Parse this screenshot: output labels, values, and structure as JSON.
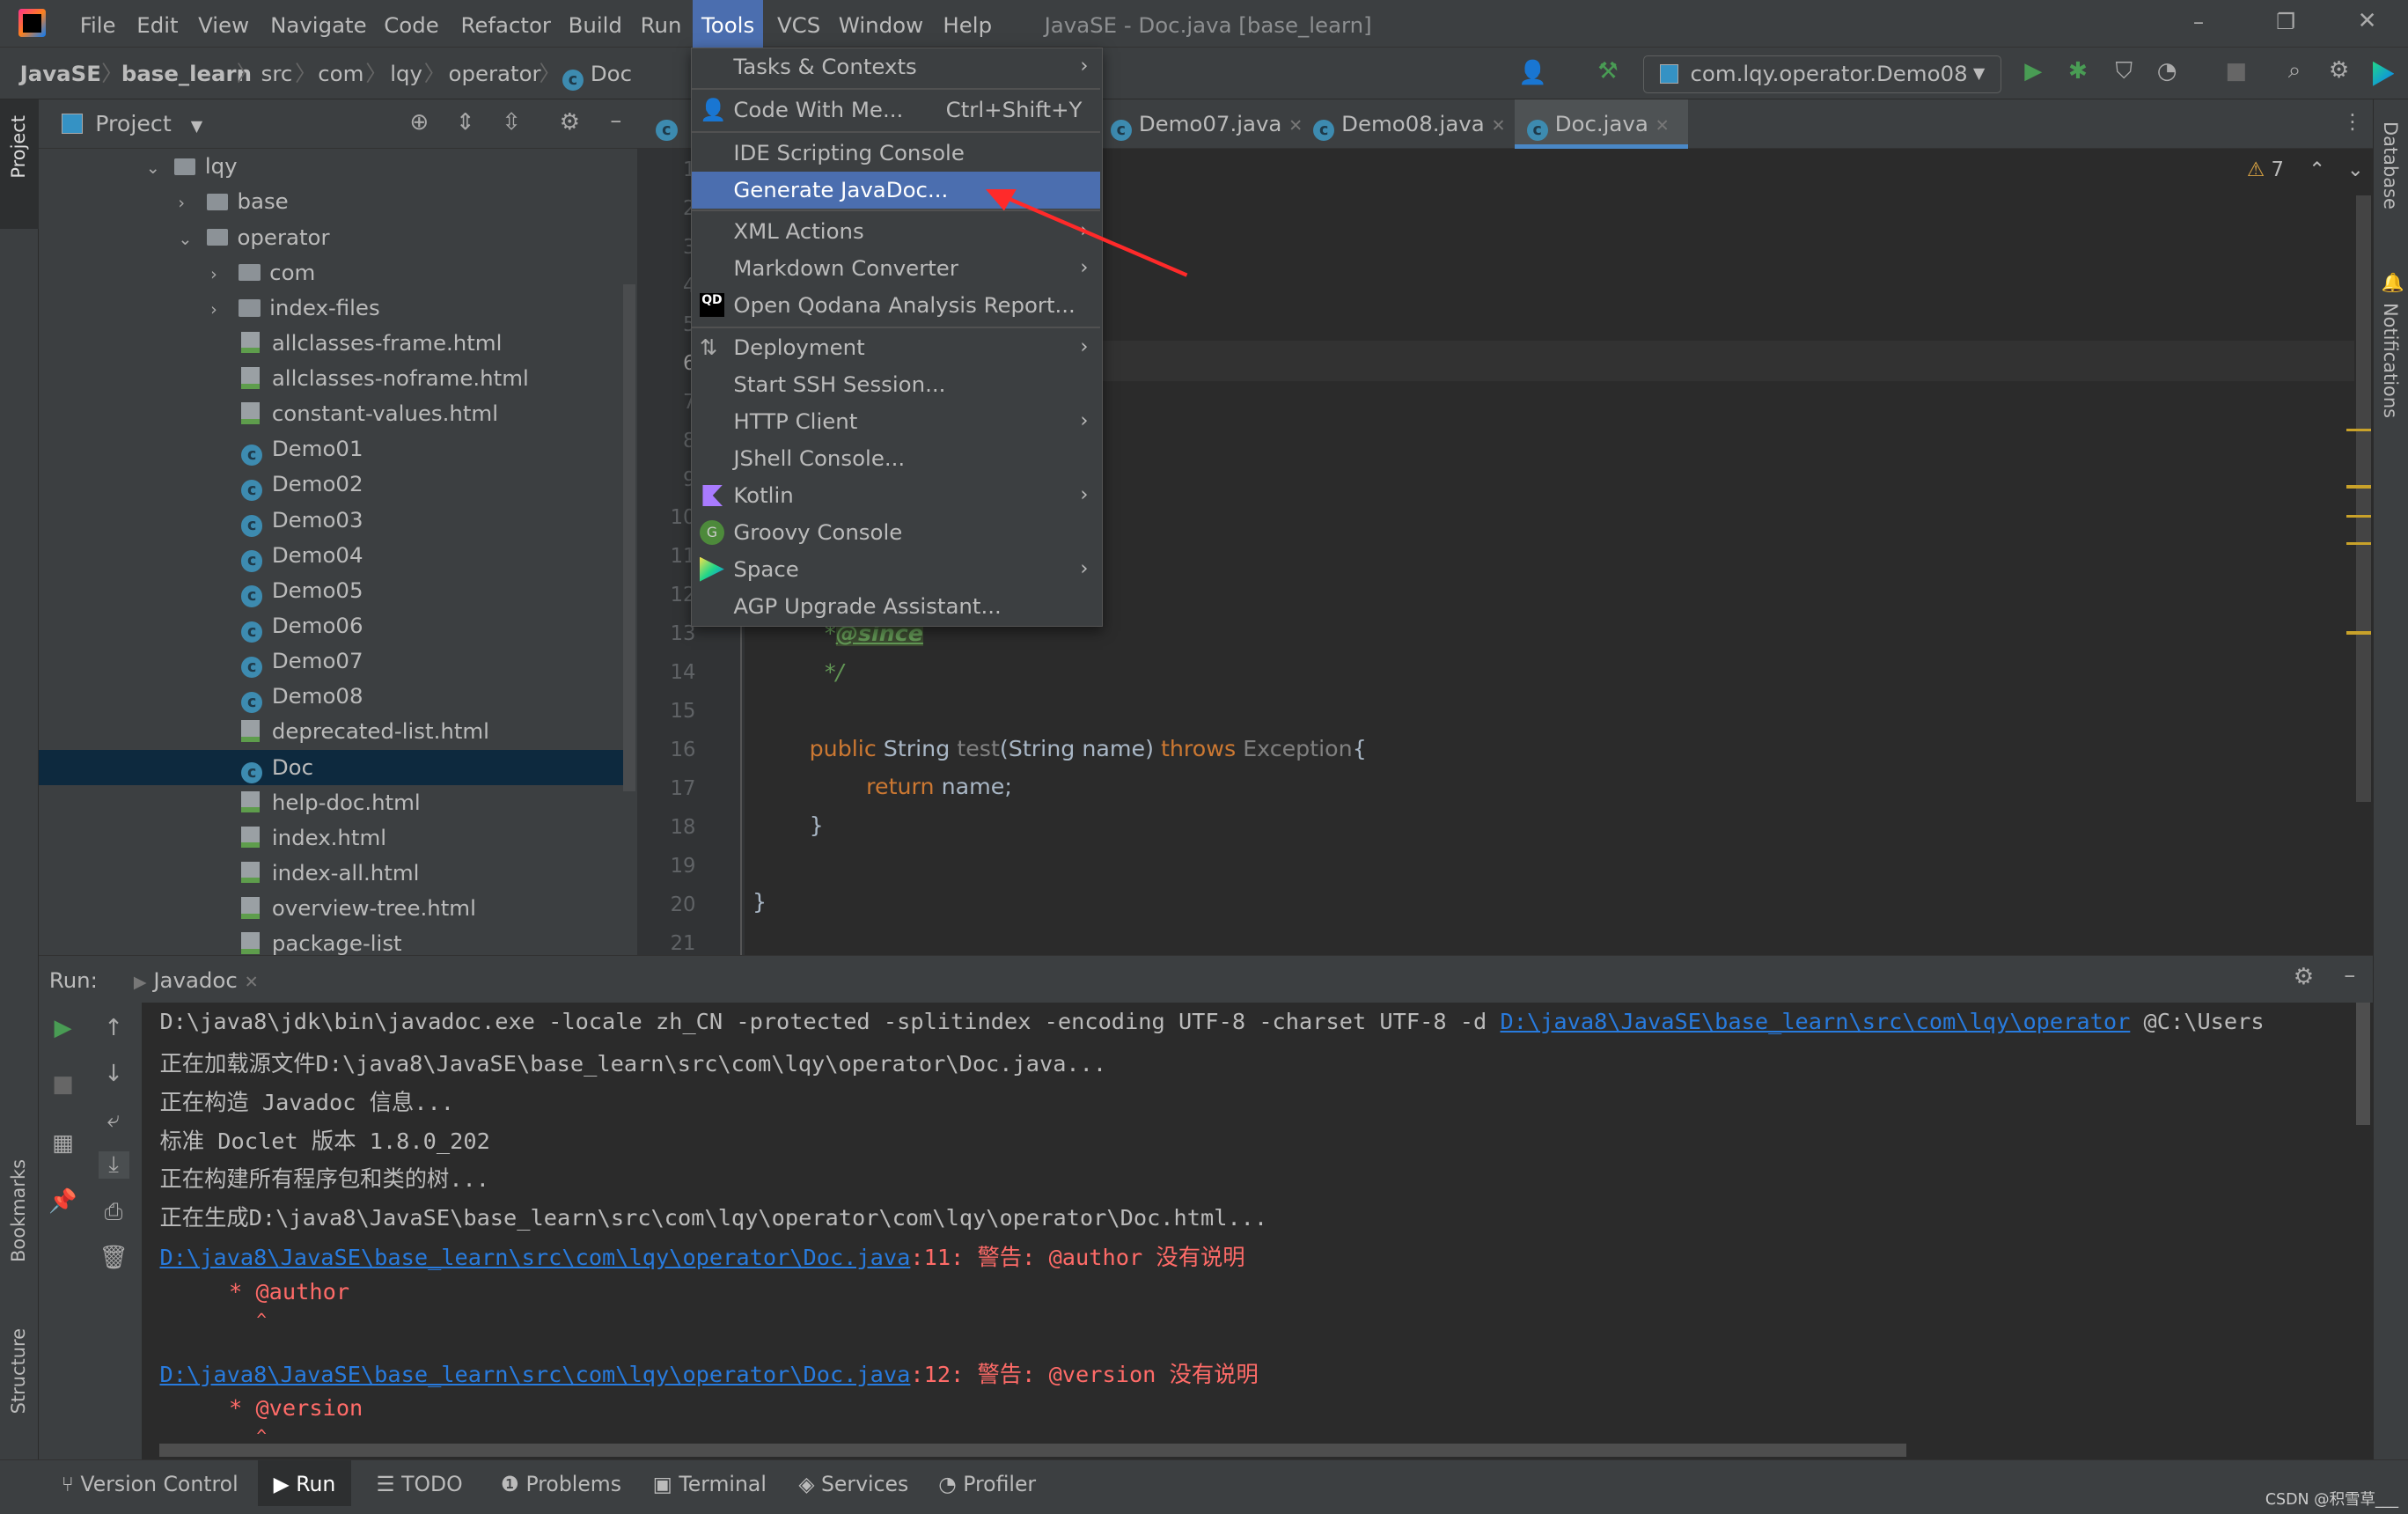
{
  "menubar": {
    "items": [
      "File",
      "Edit",
      "View",
      "Navigate",
      "Code",
      "Refactor",
      "Build",
      "Run",
      "Tools",
      "VCS",
      "Window",
      "Help"
    ],
    "active": "Tools",
    "window_title": "JavaSE - Doc.java [base_learn]"
  },
  "breadcrumb": [
    "JavaSE",
    "base_learn",
    "src",
    "com",
    "lqy",
    "operator",
    "Doc"
  ],
  "toolbar": {
    "run_config": "com.lqy.operator.Demo08"
  },
  "project": {
    "title": "Project",
    "tree": [
      {
        "label": "lqy",
        "type": "folder",
        "depth": 0,
        "expanded": true
      },
      {
        "label": "base",
        "type": "folder",
        "depth": 1,
        "expanded": false
      },
      {
        "label": "operator",
        "type": "folder",
        "depth": 1,
        "expanded": true
      },
      {
        "label": "com",
        "type": "folder",
        "depth": 2,
        "expanded": false
      },
      {
        "label": "index-files",
        "type": "folder",
        "depth": 2,
        "expanded": false
      },
      {
        "label": "allclasses-frame.html",
        "type": "html",
        "depth": 2
      },
      {
        "label": "allclasses-noframe.html",
        "type": "html",
        "depth": 2
      },
      {
        "label": "constant-values.html",
        "type": "html",
        "depth": 2
      },
      {
        "label": "Demo01",
        "type": "class",
        "depth": 2
      },
      {
        "label": "Demo02",
        "type": "class",
        "depth": 2
      },
      {
        "label": "Demo03",
        "type": "class",
        "depth": 2
      },
      {
        "label": "Demo04",
        "type": "class",
        "depth": 2
      },
      {
        "label": "Demo05",
        "type": "class",
        "depth": 2
      },
      {
        "label": "Demo06",
        "type": "class",
        "depth": 2
      },
      {
        "label": "Demo07",
        "type": "class",
        "depth": 2
      },
      {
        "label": "Demo08",
        "type": "class",
        "depth": 2
      },
      {
        "label": "deprecated-list.html",
        "type": "html",
        "depth": 2
      },
      {
        "label": "Doc",
        "type": "class",
        "depth": 2,
        "selected": true
      },
      {
        "label": "help-doc.html",
        "type": "html",
        "depth": 2
      },
      {
        "label": "index.html",
        "type": "html",
        "depth": 2
      },
      {
        "label": "index-all.html",
        "type": "html",
        "depth": 2
      },
      {
        "label": "overview-tree.html",
        "type": "html",
        "depth": 2
      },
      {
        "label": "package-list",
        "type": "file",
        "depth": 2
      }
    ]
  },
  "editor": {
    "tabs": [
      {
        "label": "Demo07.java"
      },
      {
        "label": "Demo08.java"
      },
      {
        "label": "Doc.java",
        "active": true
      }
    ],
    "warnings": "7",
    "line_numbers": [
      "1",
      "2",
      "3",
      "4",
      "5",
      "6",
      "7",
      "8",
      "9",
      "10",
      "11",
      "12",
      "13",
      "14",
      "15",
      "16",
      "17",
      "18",
      "19",
      "20",
      "21"
    ],
    "code": {
      "l13_star": "*",
      "l13_tag": "@since",
      "l14": "*/",
      "l16_public": "public",
      "l16_string": "String",
      "l16_test": "test",
      "l16_params": "(String name)",
      "l16_throws": "throws",
      "l16_exc": "Exception",
      "l16_brace": "{",
      "l17_return": "return",
      "l17_rest": "name;",
      "l18": "}",
      "l20": "}"
    }
  },
  "tools_menu": {
    "items": [
      {
        "label": "Tasks & Contexts",
        "submenu": true
      },
      {
        "label": "Code With Me...",
        "shortcut": "Ctrl+Shift+Y"
      },
      {
        "label": "IDE Scripting Console"
      },
      {
        "label": "Generate JavaDoc...",
        "highlighted": true
      },
      {
        "label": "XML Actions",
        "submenu": true
      },
      {
        "label": "Markdown Converter",
        "submenu": true
      },
      {
        "label": "Open Qodana Analysis Report..."
      },
      {
        "label": "Deployment",
        "submenu": true
      },
      {
        "label": "Start SSH Session..."
      },
      {
        "label": "HTTP Client",
        "submenu": true
      },
      {
        "label": "JShell Console..."
      },
      {
        "label": "Kotlin",
        "submenu": true
      },
      {
        "label": "Groovy Console"
      },
      {
        "label": "Space",
        "submenu": true
      },
      {
        "label": "AGP Upgrade Assistant..."
      }
    ],
    "qodana_icon_text": "QD",
    "groovy_icon_text": "G",
    "annotation_arrow_color": "#ff2a2a"
  },
  "run": {
    "label": "Run:",
    "tab": "Javadoc",
    "console": {
      "l1_cmd": "D:\\java8\\jdk\\bin\\javadoc.exe -locale zh_CN -protected -splitindex -encoding UTF-8 -charset UTF-8 -d ",
      "l1_link": "D:\\java8\\JavaSE\\base_learn\\src\\com\\lqy\\operator",
      "l1_tail": " @C:\\Users",
      "l2": "正在加载源文件D:\\java8\\JavaSE\\base_learn\\src\\com\\lqy\\operator\\Doc.java...",
      "l3": "正在构造 Javadoc 信息...",
      "l4": "标准 Doclet 版本 1.8.0_202",
      "l5": "正在构建所有程序包和类的树...",
      "l6": "正在生成D:\\java8\\JavaSE\\base_learn\\src\\com\\lqy\\operator\\com\\lqy\\operator\\Doc.html...",
      "w1_link": "D:\\java8\\JavaSE\\base_learn\\src\\com\\lqy\\operator\\Doc.java",
      "w1_msg": ":11: 警告: @author 没有说明",
      "w1_src": "* @author",
      "w1_caret": "^",
      "w2_link": "D:\\java8\\JavaSE\\base_learn\\src\\com\\lqy\\operator\\Doc.java",
      "w2_msg": ":12: 警告: @version 没有说明",
      "w2_src": "* @version",
      "w2_caret": "^"
    }
  },
  "bottom_tools": [
    "Version Control",
    "Run",
    "TODO",
    "Problems",
    "Terminal",
    "Services",
    "Profiler"
  ],
  "side_stripes": {
    "left": [
      "Project",
      "Bookmarks",
      "Structure"
    ],
    "right": [
      "Database",
      "Notifications"
    ]
  },
  "watermark": "CSDN @积雪草___"
}
